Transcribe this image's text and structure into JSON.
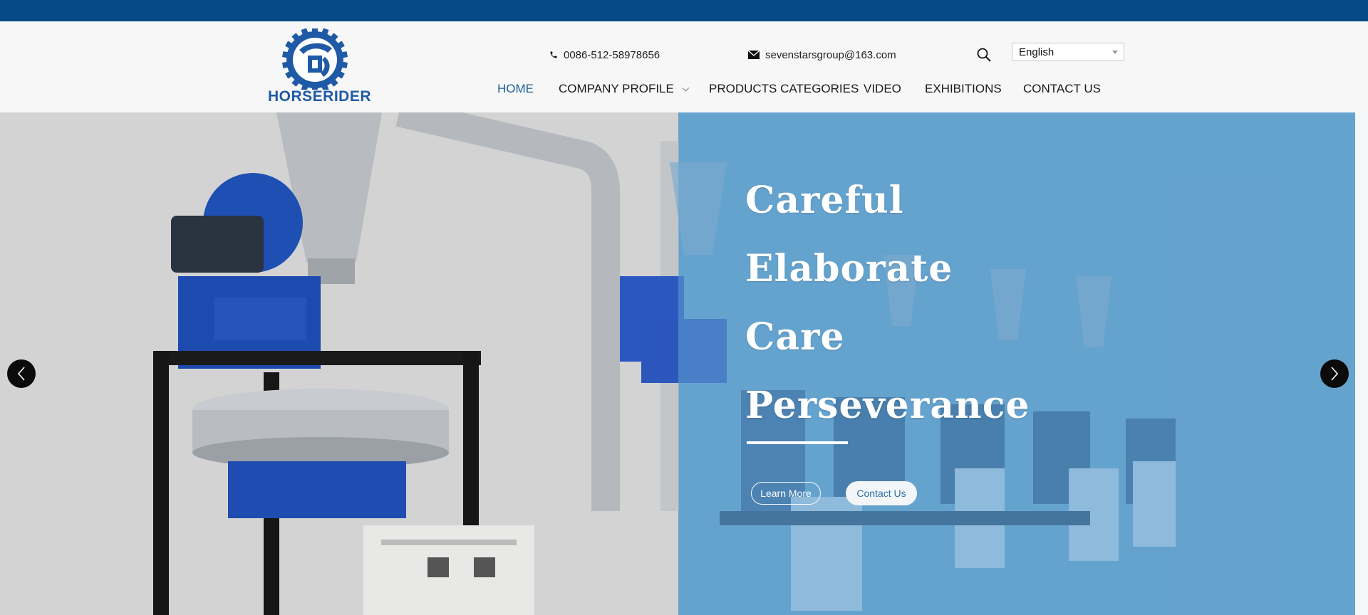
{
  "brand": {
    "name": "HORSERIDER"
  },
  "contact": {
    "phone": "0086-512-58978656",
    "email": "sevenstarsgroup@163.com"
  },
  "language_select": {
    "value": "English"
  },
  "nav": {
    "items": [
      {
        "label": "HOME",
        "active": true
      },
      {
        "label": "COMPANY PROFILE",
        "has_dropdown": true
      },
      {
        "label": "PRODUCTS CATEGORIES"
      },
      {
        "label": "VIDEO"
      },
      {
        "label": "EXHIBITIONS"
      },
      {
        "label": "CONTACT US"
      }
    ]
  },
  "hero": {
    "slogan": [
      "Careful",
      "Elaborate",
      "Care",
      "Perseverance"
    ],
    "learn_more_label": "Learn More",
    "contact_us_label": "Contact Us"
  },
  "colors": {
    "top_bar": "#064a87",
    "nav_active": "#1d5e97",
    "hero_overlay": "#6ba7d0",
    "brand_blue": "#1f5aa6"
  },
  "icons": {
    "phone": "phone-icon",
    "email": "envelope-icon",
    "search": "search-icon",
    "prev": "chevron-left-icon",
    "next": "chevron-right-icon"
  }
}
